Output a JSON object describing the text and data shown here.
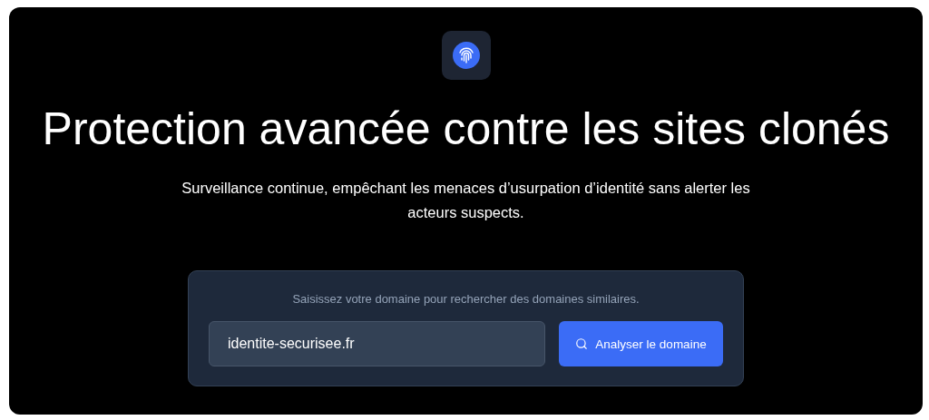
{
  "hero": {
    "title": "Protection avancée contre les sites clonés",
    "subtitle": "Surveillance continue, empêchant les menaces d’usurpation d’identité sans alerter les acteurs suspects."
  },
  "search": {
    "caption": "Saisissez votre domaine pour rechercher des domaines similaires.",
    "value": "identite-securisee.fr",
    "button": "Analyser le domaine"
  }
}
